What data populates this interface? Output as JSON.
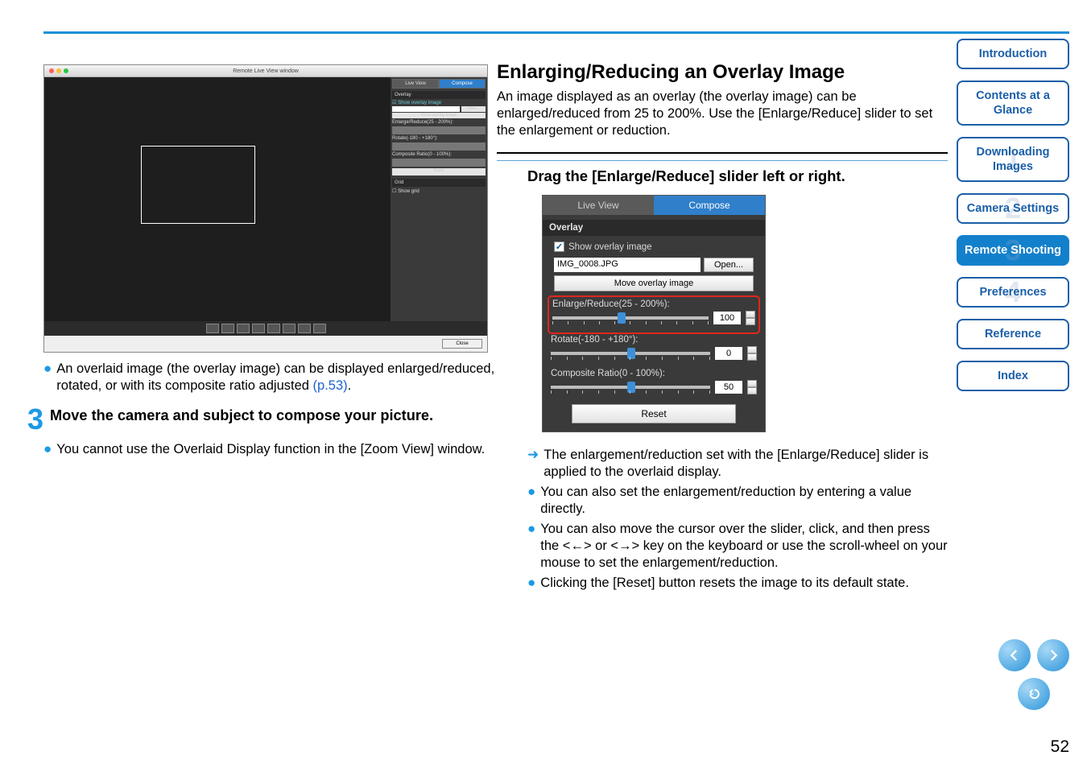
{
  "top_rule": true,
  "left": {
    "window_title": "Remote Live View window",
    "close_label": "Close",
    "side_panel": {
      "tab_live": "Live View",
      "tab_compose": "Compose",
      "section_overlay": "Overlay",
      "check_label": "Show overlay image",
      "file_value": "IMG_0008.JPG",
      "open_label": "Open...",
      "move_label": "Move overlay image",
      "enlarge_label": "Enlarge/Reduce(25 - 200%):",
      "enlarge_value": "100",
      "rotate_label": "Rotate(-180 - +180°):",
      "rotate_value": "0",
      "ratio_label": "Composite Ratio(0 - 100%):",
      "ratio_value": "50",
      "reset_label": "Reset",
      "section_grid": "Grid",
      "grid_check": "Show grid"
    },
    "bullets": {
      "b1": "An overlaid image (the overlay image) can be displayed enlarged/reduced, rotated, or with its composite ratio adjusted ",
      "b1_link": "(p.53)",
      "b1_suffix": "."
    },
    "step": {
      "num": "3",
      "text": "Move the camera and subject to compose your picture."
    },
    "step_bullet": "You cannot use the Overlaid Display function in the [Zoom View] window."
  },
  "right": {
    "heading": "Enlarging/Reducing an Overlay Image",
    "intro": "An image displayed as an overlay (the overlay image) can be enlarged/reduced from 25 to 200%. Use the [Enlarge/Reduce] slider to set the enlargement or reduction.",
    "subhead": "Drag the [Enlarge/Reduce] slider left or right.",
    "panel": {
      "tab_live": "Live View",
      "tab_compose": "Compose",
      "section_overlay": "Overlay",
      "check_label": "Show overlay image",
      "file_value": "IMG_0008.JPG",
      "open_label": "Open...",
      "move_label": "Move overlay image",
      "enlarge_label": "Enlarge/Reduce(25 - 200%):",
      "enlarge_value": "100",
      "rotate_label": "Rotate(-180 - +180°):",
      "rotate_value": "0",
      "ratio_label": "Composite Ratio(0 - 100%):",
      "ratio_value": "50",
      "reset_label": "Reset"
    },
    "result": "The enlargement/reduction set with the [Enlarge/Reduce] slider is applied to the overlaid display.",
    "b2": "You can also set the enlargement/reduction by entering a value directly.",
    "b3": "You can also move the cursor over the slider, click, and then press the <←> or <→> key on the keyboard or use the scroll-wheel on your mouse to set the enlargement/reduction.",
    "b4": "Clicking the [Reset] button resets the image to its default state."
  },
  "sidebar": {
    "items": [
      {
        "label": "Introduction",
        "ghost": ""
      },
      {
        "label": "Contents at a Glance",
        "ghost": ""
      },
      {
        "label": "Downloading Images",
        "ghost": "1"
      },
      {
        "label": "Camera Settings",
        "ghost": "2"
      },
      {
        "label": "Remote Shooting",
        "ghost": "3",
        "active": true
      },
      {
        "label": "Preferences",
        "ghost": "4"
      },
      {
        "label": "Reference",
        "ghost": ""
      },
      {
        "label": "Index",
        "ghost": ""
      }
    ]
  },
  "page_number": "52"
}
